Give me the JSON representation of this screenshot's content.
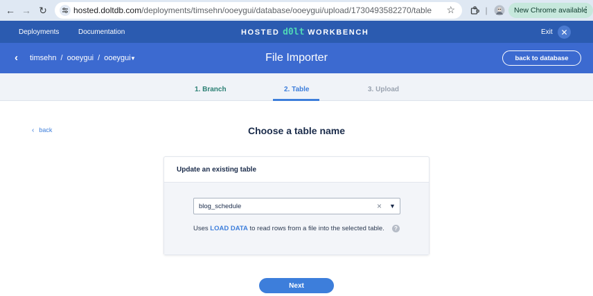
{
  "browser": {
    "url_host": "hosted.doltdb.com",
    "url_path": "/deployments/timsehn/ooeygui/database/ooeygui/upload/1730493582270/table",
    "new_chrome_label": "New Chrome available"
  },
  "topnav": {
    "deployments": "Deployments",
    "documentation": "Documentation",
    "brand_left": "HOSTED",
    "brand_mid": "d0lt",
    "brand_right": "WORKBENCH",
    "exit": "Exit"
  },
  "header": {
    "crumb_owner": "timsehn",
    "crumb_deployment": "ooeygui",
    "crumb_database": "ooeygui",
    "title": "File Importer",
    "back_to_database": "back to database"
  },
  "steps": [
    {
      "label": "1. Branch",
      "state": "completed"
    },
    {
      "label": "2. Table",
      "state": "active"
    },
    {
      "label": "3. Upload",
      "state": "pending"
    }
  ],
  "content": {
    "back": "back",
    "heading": "Choose a table name",
    "card_title": "Update an existing table",
    "selected_table": "blog_schedule",
    "hint_prefix": "Uses ",
    "hint_keyword": "LOAD DATA",
    "hint_suffix": " to read rows from a file into the selected table.",
    "next": "Next"
  },
  "colors": {
    "nav_blue": "#2b5bb0",
    "header_blue": "#3c6ad0",
    "accent_blue": "#3d7edb",
    "teal": "#2a7f73"
  }
}
